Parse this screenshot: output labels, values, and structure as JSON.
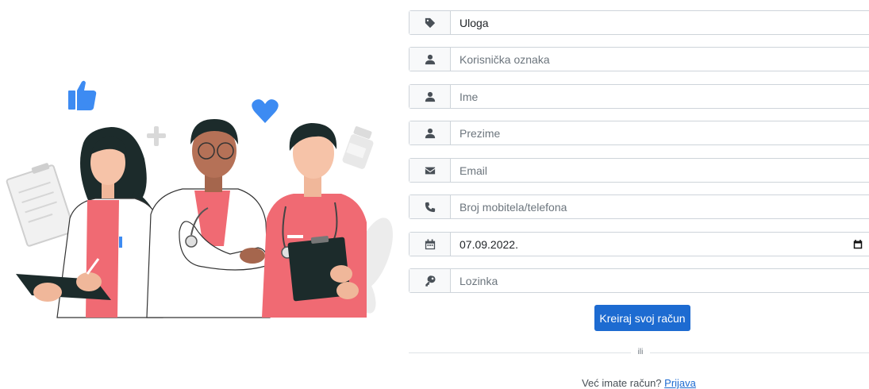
{
  "form": {
    "role": {
      "value": "Uloga",
      "icon": "tag-icon"
    },
    "username": {
      "placeholder": "Korisnička oznaka",
      "icon": "user-icon"
    },
    "first_name": {
      "placeholder": "Ime",
      "icon": "user-icon"
    },
    "last_name": {
      "placeholder": "Prezime",
      "icon": "user-icon"
    },
    "email": {
      "placeholder": "Email",
      "icon": "envelope-icon"
    },
    "phone": {
      "placeholder": "Broj mobitela/telefona",
      "icon": "phone-icon"
    },
    "birth_date": {
      "value": "07.09.2022.",
      "icon": "calendar-icon"
    },
    "password": {
      "placeholder": "Lozinka",
      "icon": "key-icon"
    },
    "submit_label": "Kreiraj svoj račun",
    "divider_text": "ili",
    "login_prompt": "Već imate račun?",
    "login_link": "Prijava"
  },
  "colors": {
    "primary": "#1d6bd1",
    "scrub_pink": "#f06a73",
    "like_blue": "#3d8bf2"
  }
}
